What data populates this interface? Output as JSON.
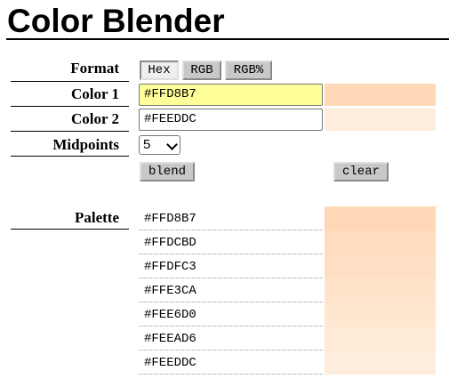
{
  "title": "Color Blender",
  "labels": {
    "format": "Format",
    "color1": "Color 1",
    "color2": "Color 2",
    "midpoints": "Midpoints",
    "palette": "Palette"
  },
  "format_buttons": [
    "Hex",
    "RGB",
    "RGB%"
  ],
  "active_format": "Hex",
  "color1": {
    "value": "#FFD8B7",
    "swatch": "#FFD8B7",
    "field_bg": "#FFFF99"
  },
  "color2": {
    "value": "#FEEDDC",
    "swatch": "#FEEDDC"
  },
  "midpoints": {
    "value": "5"
  },
  "buttons": {
    "blend": "blend",
    "clear": "clear"
  },
  "palette": [
    {
      "hex": "#FFD8B7"
    },
    {
      "hex": "#FFDCBD"
    },
    {
      "hex": "#FFDFC3"
    },
    {
      "hex": "#FFE3CA"
    },
    {
      "hex": "#FEE6D0"
    },
    {
      "hex": "#FEEAD6"
    },
    {
      "hex": "#FEEDDC"
    }
  ],
  "icons": {
    "dropdown": "chevron-down-icon"
  }
}
